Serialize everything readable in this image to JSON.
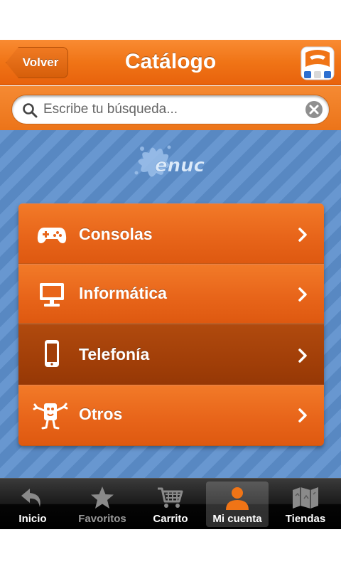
{
  "navbar": {
    "back_label": "Volver",
    "title": "Catálogo"
  },
  "search": {
    "placeholder": "Escribe tu búsqueda...",
    "value": ""
  },
  "watermark": {
    "text": "enuc"
  },
  "menu": {
    "items": [
      {
        "label": "Consolas",
        "icon": "gamepad-icon",
        "selected": false
      },
      {
        "label": "Informática",
        "icon": "monitor-icon",
        "selected": false
      },
      {
        "label": "Telefonía",
        "icon": "phone-icon",
        "selected": true
      },
      {
        "label": "Otros",
        "icon": "mascot-icon",
        "selected": false
      }
    ]
  },
  "tabbar": {
    "tabs": [
      {
        "label": "Inicio",
        "icon": "back-arrow-icon",
        "active": false
      },
      {
        "label": "Favoritos",
        "icon": "star-icon",
        "active": false
      },
      {
        "label": "Carrito",
        "icon": "cart-icon",
        "active": false
      },
      {
        "label": "Mi cuenta",
        "icon": "user-icon",
        "active": true
      },
      {
        "label": "Tiendas",
        "icon": "map-icon",
        "active": false
      }
    ]
  },
  "colors": {
    "accent_orange": "#f07416",
    "selected_row": "#a23f08",
    "background_blue": "#5d8fcc",
    "tabbar_black": "#000000"
  }
}
